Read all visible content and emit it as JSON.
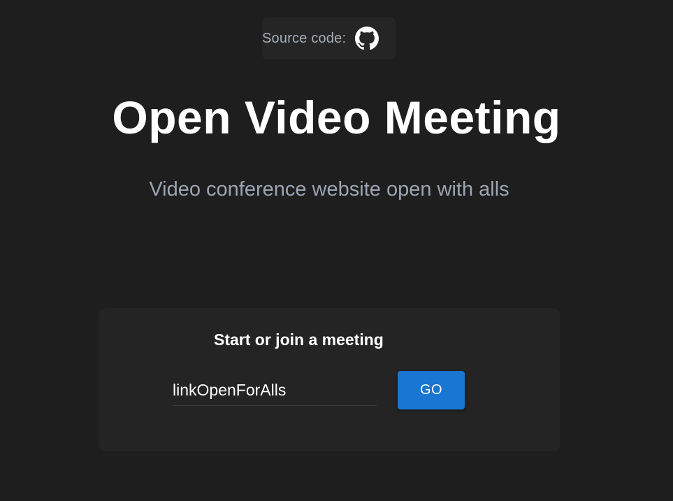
{
  "header": {
    "source_label": "Source code:",
    "github_icon": "github-icon"
  },
  "hero": {
    "title": "Open Video Meeting",
    "subtitle": "Video conference website open with alls"
  },
  "meeting_card": {
    "heading": "Start or join a meeting",
    "input_value": "linkOpenForAlls",
    "go_label": "GO"
  },
  "colors": {
    "background": "#1e1e1e",
    "card": "#242424",
    "accent": "#1976d2",
    "subtitle": "#9ba5b4"
  }
}
